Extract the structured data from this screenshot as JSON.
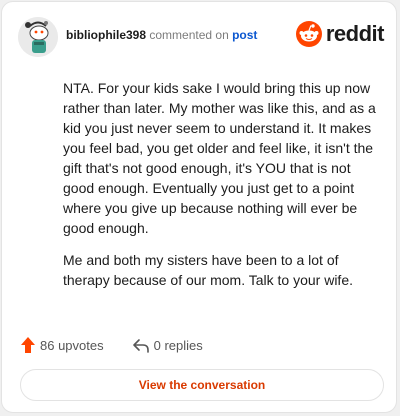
{
  "header": {
    "username": "bibliophile398",
    "commented_on": "commented on",
    "post_link": "post",
    "brand": "reddit",
    "avatar_icon": "snoo-avatar-icon",
    "logo_icon": "reddit-snoo-logo-icon"
  },
  "comment": {
    "paragraphs": [
      "NTA. For your kids sake I would bring this up now rather than later. My mother was like this, and as a kid you just never seem to understand it. It makes you feel bad, you get older and feel like, it isn't the gift that's not good enough, it's YOU that is not good enough. Eventually you just get to a point where you give up because nothing will ever be good enough.",
      "Me and both my sisters have been to a lot of therapy because of our mom. Talk to your wife."
    ]
  },
  "actions": {
    "upvotes": "86 upvotes",
    "replies": "0 replies",
    "upvote_icon": "upvote-arrow-icon",
    "reply_icon": "reply-arrow-icon"
  },
  "footer": {
    "view_button": "View the conversation"
  },
  "colors": {
    "brand_orange": "#ff4500",
    "link_blue": "#0b57d0",
    "button_text": "#d93a00",
    "upvote": "#ff4500"
  }
}
